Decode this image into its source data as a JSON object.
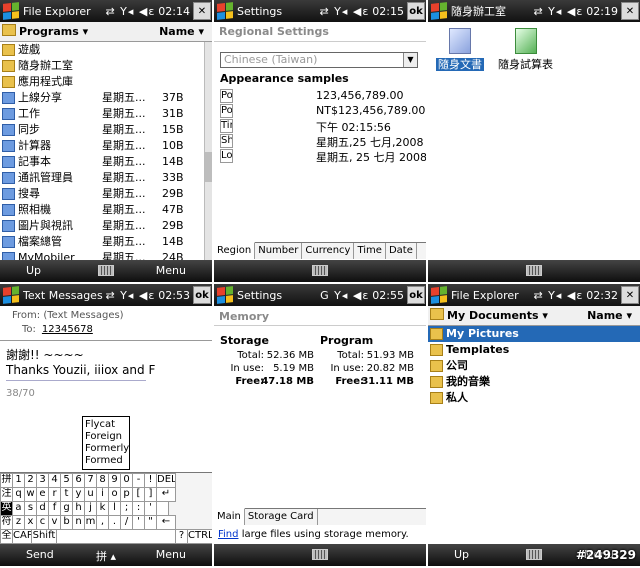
{
  "screen1": {
    "title": "File Explorer",
    "status_icons": "⇄ Y◂ ◀ε",
    "time": "02:14",
    "close_label": "✕",
    "path": "Programs ▾",
    "sort": "Name ▾",
    "rows": [
      {
        "name": "遊戲",
        "date": "",
        "size": "",
        "type": "folder",
        "selected": false
      },
      {
        "name": "隨身辦工室",
        "date": "",
        "size": "",
        "type": "folder",
        "selected": false
      },
      {
        "name": "應用程式庫",
        "date": "",
        "size": "",
        "type": "folder",
        "selected": false
      },
      {
        "name": "上線分享",
        "date": "星期五...",
        "size": "37B",
        "type": "app",
        "selected": false
      },
      {
        "name": "工作",
        "date": "星期五...",
        "size": "31B",
        "type": "app",
        "selected": false
      },
      {
        "name": "同步",
        "date": "星期五...",
        "size": "15B",
        "type": "app",
        "selected": false
      },
      {
        "name": "計算器",
        "date": "星期五...",
        "size": "10B",
        "type": "app",
        "selected": false
      },
      {
        "name": "記事本",
        "date": "星期五...",
        "size": "14B",
        "type": "app",
        "selected": false
      },
      {
        "name": "通訊管理員",
        "date": "星期五...",
        "size": "33B",
        "type": "app",
        "selected": false
      },
      {
        "name": "搜尋",
        "date": "星期五...",
        "size": "29B",
        "type": "app",
        "selected": false
      },
      {
        "name": "照相機",
        "date": "星期五...",
        "size": "47B",
        "type": "app",
        "selected": false
      },
      {
        "name": "圖片與視訊",
        "date": "星期五...",
        "size": "29B",
        "type": "app",
        "selected": false
      },
      {
        "name": "檔案總管",
        "date": "星期五...",
        "size": "14B",
        "type": "app",
        "selected": false
      },
      {
        "name": "MyMobiler",
        "date": "星期五...",
        "size": "24B",
        "type": "app",
        "selected": false
      }
    ],
    "soft_left": "Up",
    "soft_right": "Menu"
  },
  "screen2": {
    "title": "Settings",
    "status_icons": "⇄ Y◂ ◀ε",
    "time": "02:15",
    "ok_label": "ok",
    "header": "Regional Settings",
    "locale": "Chinese (Taiwan)",
    "samples_title": "Appearance samples",
    "samples": [
      {
        "label": "Positive numbers:",
        "value": "123,456,789.00"
      },
      {
        "label": "Positive currency:",
        "value": "NT$123,456,789.00"
      },
      {
        "label": "Time:",
        "value": "下午 02:15:56"
      },
      {
        "label": "Short date:",
        "value": "星期五,25 七月,2008"
      },
      {
        "label": "Long date:",
        "value": "星期五, 25 七月 2008"
      }
    ],
    "tabs": [
      "Region",
      "Number",
      "Currency",
      "Time",
      "Date"
    ]
  },
  "screen3": {
    "title": "隨身辦工室",
    "status_icons": "⇄ Y◂ ◀ε",
    "time": "02:19",
    "close_label": "✕",
    "items": [
      "隨身文書",
      "隨身試算表"
    ]
  },
  "screen4": {
    "title": "Text Messages",
    "status_icons": "⇄ Y◂ ◀ε",
    "time": "02:53",
    "ok_label": "ok",
    "from_label": "From:",
    "from_value": "(Text Messages)",
    "to_label": "To:",
    "to_value": "12345678",
    "body_line1": "謝謝!! ~~~~",
    "body_line2": "Thanks Youzii, iiiox and F",
    "counter": "38/70",
    "suggestions": [
      "Flycat",
      "Foreign",
      "Formerly",
      "Formed"
    ],
    "kbd_rows": [
      [
        "拼",
        "1",
        "2",
        "3",
        "4",
        "5",
        "6",
        "7",
        "8",
        "9",
        "0",
        "-",
        "!",
        "DEL"
      ],
      [
        "注",
        "q",
        "w",
        "e",
        "r",
        "t",
        "y",
        "u",
        "i",
        "o",
        "p",
        "[",
        "]",
        "↵"
      ],
      [
        "英",
        "a",
        "s",
        "d",
        "f",
        "g",
        "h",
        "j",
        "k",
        "l",
        ";",
        ":",
        "'",
        ""
      ],
      [
        "符",
        "z",
        "x",
        "c",
        "v",
        "b",
        "n",
        "m",
        ",",
        ".",
        "/",
        "'",
        "\"",
        "←"
      ],
      [
        "全",
        "CAP",
        "Shift",
        " ",
        "?",
        "CTRL"
      ]
    ],
    "soft_left": "Send",
    "soft_mid": "拼 ▴",
    "soft_right": "Menu"
  },
  "screen5": {
    "title": "Settings",
    "status_icons": "G Y◂ ◀ε",
    "time": "02:55",
    "ok_label": "ok",
    "header": "Memory",
    "storage": {
      "title": "Storage",
      "total_label": "Total:",
      "total": "52.36 MB",
      "inuse_label": "In use:",
      "inuse": "5.19 MB",
      "free_label": "Free:",
      "free": "47.18 MB"
    },
    "program": {
      "title": "Program",
      "total_label": "Total:",
      "total": "51.93 MB",
      "inuse_label": "In use:",
      "inuse": "20.82 MB",
      "free_label": "Free:",
      "free": "31.11 MB"
    },
    "tabs": [
      "Main",
      "Storage Card"
    ],
    "find_link": "Find",
    "find_text": "large files using storage memory."
  },
  "screen6": {
    "title": "File Explorer",
    "status_icons": "⇄ Y◂ ◀ε",
    "time": "02:32",
    "close_label": "✕",
    "path": "My Documents ▾",
    "sort": "Name ▾",
    "rows": [
      {
        "name": "My Pictures",
        "selected": true
      },
      {
        "name": "Templates",
        "selected": false
      },
      {
        "name": "公司",
        "selected": false
      },
      {
        "name": "我的音樂",
        "selected": false
      },
      {
        "name": "私人",
        "selected": false
      }
    ],
    "soft_left": "Up",
    "soft_right": "Menu"
  },
  "watermark": "#249329"
}
